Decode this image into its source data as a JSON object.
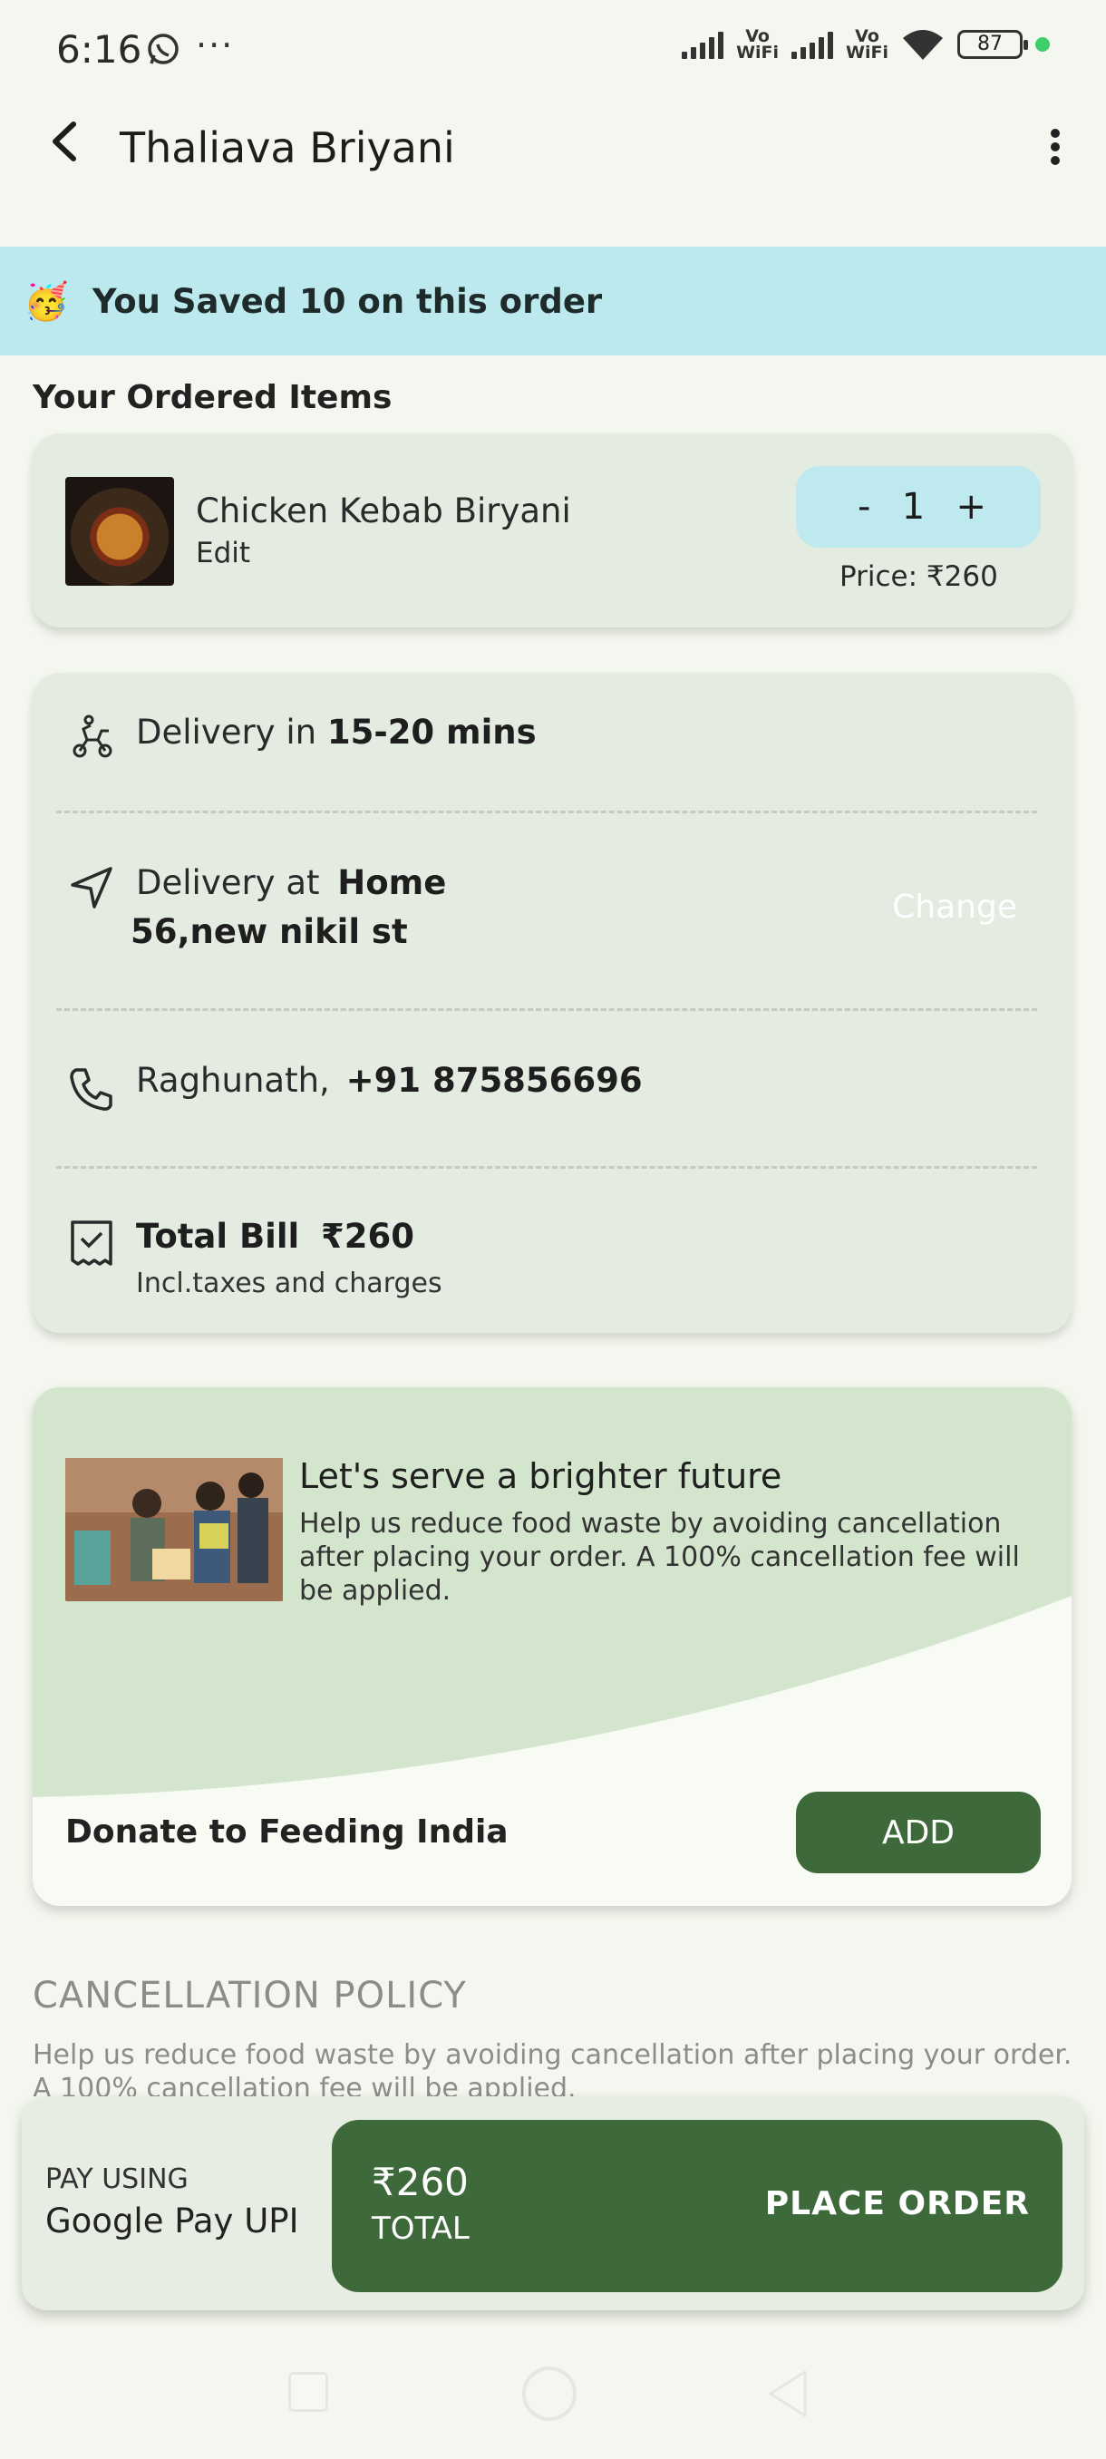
{
  "status_bar": {
    "time": "6:16",
    "dots": "···",
    "vowifi_1": "Vo\nWiFi",
    "vowifi_2": "Vo\nWiFi",
    "battery": "87"
  },
  "app_bar": {
    "title": "Thaliava Briyani"
  },
  "banner": {
    "emoji": "🥳",
    "text": "You Saved 10 on this order"
  },
  "ordered_items": {
    "section_title": "Your Ordered Items",
    "items": [
      {
        "name": "Chicken Kebab Biryani",
        "edit_label": "Edit",
        "minus": "-",
        "quantity": "1",
        "plus": "+",
        "price": "Price: ₹260"
      }
    ]
  },
  "details": {
    "delivery_time_prefix": "Delivery in",
    "delivery_time": "15-20 mins",
    "delivery_at_prefix": "Delivery at",
    "delivery_place": "Home",
    "address": "56,new nikil st",
    "change_label": "Change",
    "contact_name": "Raghunath,",
    "contact_phone": "+91 875856696",
    "total_label": "Total Bill",
    "total_amount": "₹260",
    "total_note": "Incl.taxes and charges"
  },
  "donation": {
    "title": "Let's serve a brighter future",
    "description": "Help us reduce food waste by avoiding cancellation after placing your order. A 100% cancellation fee will be applied.",
    "label": "Donate to Feeding India",
    "add_label": "ADD"
  },
  "cancellation": {
    "title": "CANCELLATION POLICY",
    "text": "Help us reduce food waste by avoiding cancellation after placing your order. A 100% cancellation fee will be applied."
  },
  "payment": {
    "pay_using_label": "PAY USING",
    "method": "Google Pay UPI",
    "total_amount": "₹260",
    "total_label": "TOTAL",
    "place_order_label": "PLACE ORDER"
  },
  "colors": {
    "banner_bg": "#bbe9ee",
    "card_bg": "#e4ebe0",
    "primary_green": "#3e6a3b",
    "page_bg": "#f4f7ef",
    "donation_wave": "#d3e6cd"
  },
  "icons": [
    "whatsapp-icon",
    "back-arrow-icon",
    "more-vert-icon",
    "delivery-scooter-icon",
    "navigation-arrow-icon",
    "phone-icon",
    "receipt-icon"
  ]
}
